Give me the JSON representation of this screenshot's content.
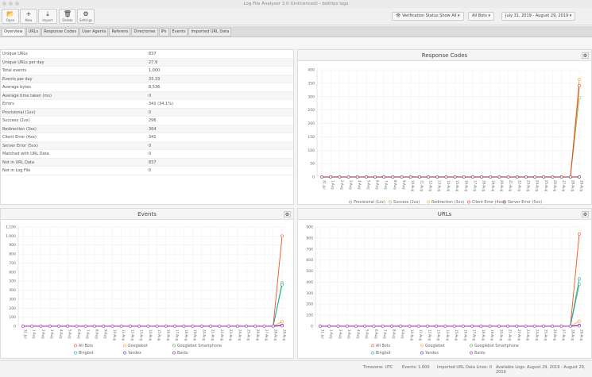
{
  "window": {
    "title": "Log File Analyser 3.0 (Unlicenced) - boktips logs"
  },
  "toolbar": {
    "open": "Open",
    "new": "New",
    "import": "Import",
    "delete": "Delete",
    "settings": "Settings",
    "verification": "Verification Status Show All",
    "bots": "All Bots",
    "date_range": "July 31, 2019 - August 29, 2019"
  },
  "tabs": [
    "Overview",
    "URLs",
    "Response Codes",
    "User Agents",
    "Referers",
    "Directories",
    "IPs",
    "Events",
    "Imported URL Data"
  ],
  "overview": [
    [
      "Unique URLs",
      "837"
    ],
    [
      "Unique URLs per day",
      "27.9"
    ],
    [
      "Total events",
      "1,000"
    ],
    [
      "Events per day",
      "33.33"
    ],
    [
      "Average bytes",
      "8,536"
    ],
    [
      "Average time taken (ms)",
      "0"
    ],
    [
      "Errors",
      "341 (34.1%)"
    ],
    [
      "Provisional (1xx)",
      "0"
    ],
    [
      "Success (2xx)",
      "296"
    ],
    [
      "Redirection (3xx)",
      "364"
    ],
    [
      "Client Error (4xx)",
      "341"
    ],
    [
      "Server Error (5xx)",
      "0"
    ],
    [
      "Matched with URL Data",
      "0"
    ],
    [
      "Not in URL Data",
      "837"
    ],
    [
      "Not in Log File",
      "0"
    ]
  ],
  "chart_data": [
    {
      "type": "line",
      "title": "Response Codes",
      "ylim": [
        0,
        400
      ],
      "yticks": [
        0,
        50,
        100,
        150,
        200,
        250,
        300,
        350,
        400
      ],
      "grid": true,
      "legend": "bottom",
      "x": [
        "31-Jul",
        "1-Aug",
        "2-Aug",
        "3-Aug",
        "4-Aug",
        "5-Aug",
        "6-Aug",
        "7-Aug",
        "8-Aug",
        "9-Aug",
        "10-Aug",
        "11-Aug",
        "12-Aug",
        "13-Aug",
        "14-Aug",
        "15-Aug",
        "16-Aug",
        "17-Aug",
        "18-Aug",
        "19-Aug",
        "20-Aug",
        "21-Aug",
        "22-Aug",
        "23-Aug",
        "24-Aug",
        "25-Aug",
        "26-Aug",
        "27-Aug",
        "28-Aug",
        "29-Aug"
      ],
      "series": [
        {
          "name": "Provisional (1xx)",
          "color": "#888888",
          "last": 0
        },
        {
          "name": "Success (2xx)",
          "color": "#8bc34a",
          "last": 296
        },
        {
          "name": "Redirection (3xx)",
          "color": "#f5a623",
          "last": 364
        },
        {
          "name": "Client Error (4xx)",
          "color": "#e53935",
          "last": 341
        },
        {
          "name": "Server Error (5xx)",
          "color": "#8e2a3a",
          "last": 0
        }
      ]
    },
    {
      "type": "line",
      "title": "Events",
      "ylim": [
        0,
        1100
      ],
      "yticks": [
        0,
        100,
        200,
        300,
        400,
        500,
        600,
        700,
        800,
        900,
        1000,
        1100
      ],
      "grid": true,
      "legend": "bottom",
      "x": [
        "31-Jul",
        "1-Aug",
        "2-Aug",
        "3-Aug",
        "4-Aug",
        "5-Aug",
        "6-Aug",
        "7-Aug",
        "8-Aug",
        "9-Aug",
        "10-Aug",
        "11-Aug",
        "12-Aug",
        "13-Aug",
        "14-Aug",
        "15-Aug",
        "16-Aug",
        "17-Aug",
        "18-Aug",
        "19-Aug",
        "20-Aug",
        "21-Aug",
        "22-Aug",
        "23-Aug",
        "24-Aug",
        "25-Aug",
        "26-Aug",
        "27-Aug",
        "28-Aug",
        "29-Aug"
      ],
      "series": [
        {
          "name": "All Bots",
          "color": "#f4511e",
          "last": 1000
        },
        {
          "name": "Googlebot",
          "color": "#f5a623",
          "last": 50
        },
        {
          "name": "Googlebot Smartphone",
          "color": "#4caf50",
          "last": 480
        },
        {
          "name": "Bingbot",
          "color": "#1fa5a5",
          "last": 460
        },
        {
          "name": "Yandex",
          "color": "#3f3fb5",
          "last": 10
        },
        {
          "name": "Baidu",
          "color": "#9c27b0",
          "last": 5
        }
      ]
    },
    {
      "type": "line",
      "title": "URLs",
      "ylim": [
        0,
        900
      ],
      "yticks": [
        0,
        100,
        200,
        300,
        400,
        500,
        600,
        700,
        800,
        900
      ],
      "grid": true,
      "legend": "bottom",
      "x": [
        "31-Jul",
        "1-Aug",
        "2-Aug",
        "3-Aug",
        "4-Aug",
        "5-Aug",
        "6-Aug",
        "7-Aug",
        "8-Aug",
        "9-Aug",
        "10-Aug",
        "11-Aug",
        "12-Aug",
        "13-Aug",
        "14-Aug",
        "15-Aug",
        "16-Aug",
        "17-Aug",
        "18-Aug",
        "19-Aug",
        "20-Aug",
        "21-Aug",
        "22-Aug",
        "23-Aug",
        "24-Aug",
        "25-Aug",
        "26-Aug",
        "27-Aug",
        "28-Aug",
        "29-Aug"
      ],
      "series": [
        {
          "name": "All Bots",
          "color": "#f4511e",
          "last": 837
        },
        {
          "name": "Googlebot",
          "color": "#f5a623",
          "last": 45
        },
        {
          "name": "Googlebot Smartphone",
          "color": "#4caf50",
          "last": 380
        },
        {
          "name": "Bingbot",
          "color": "#1fa5a5",
          "last": 430
        },
        {
          "name": "Yandex",
          "color": "#3f3fb5",
          "last": 8
        },
        {
          "name": "Baidu",
          "color": "#9c27b0",
          "last": 4
        }
      ]
    }
  ],
  "footer": {
    "timezone": "Timezone:  UTC",
    "events": "Events:  1,000",
    "imported": "Imported URL Data Lines:  0",
    "available": "Available Logs:  August 29, 2019 - August 29, 2019"
  }
}
